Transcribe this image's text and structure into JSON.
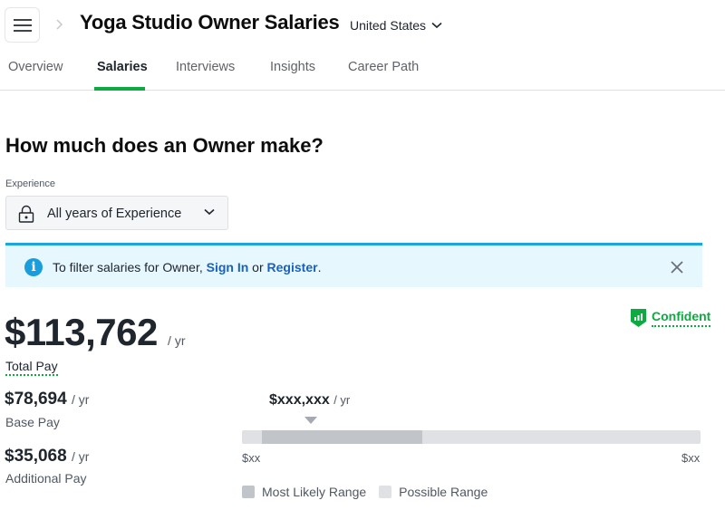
{
  "header": {
    "title": "Yoga Studio Owner Salaries",
    "country": "United States"
  },
  "tabs": [
    {
      "label": "Overview",
      "active": false
    },
    {
      "label": "Salaries",
      "active": true
    },
    {
      "label": "Interviews",
      "active": false
    },
    {
      "label": "Insights",
      "active": false
    },
    {
      "label": "Career Path",
      "active": false
    }
  ],
  "main": {
    "question": "How much does an Owner make?",
    "experience": {
      "label": "Experience",
      "selected": "All years of Experience"
    },
    "banner": {
      "prefix": "To filter salaries for Owner, ",
      "sign_in": "Sign In",
      "or": " or ",
      "register": "Register",
      "suffix": "."
    },
    "confidence": "Confident",
    "total_pay": {
      "value": "$113,762",
      "unit": "/ yr",
      "label": "Total Pay"
    },
    "base_pay": {
      "value": "$78,694",
      "unit": "/ yr",
      "label": "Base Pay"
    },
    "additional_pay": {
      "value": "$35,068",
      "unit": "/ yr",
      "label": "Additional Pay"
    },
    "range": {
      "median_value": "$xxx,xxx",
      "median_unit": "/ yr",
      "min_label": "$xx",
      "max_label": "$xx",
      "likely_start_fraction": 0.043,
      "likely_end_fraction": 0.393,
      "marker_fraction": 0.15,
      "legend": {
        "most_likely": "Most Likely Range",
        "possible": "Possible Range"
      }
    }
  },
  "colors": {
    "accent_green": "#0caa41",
    "link_blue": "#1861bf",
    "info_blue": "#1a9ddb",
    "likely_range": "#c1c4c9",
    "possible_range": "#dfe1e4"
  }
}
